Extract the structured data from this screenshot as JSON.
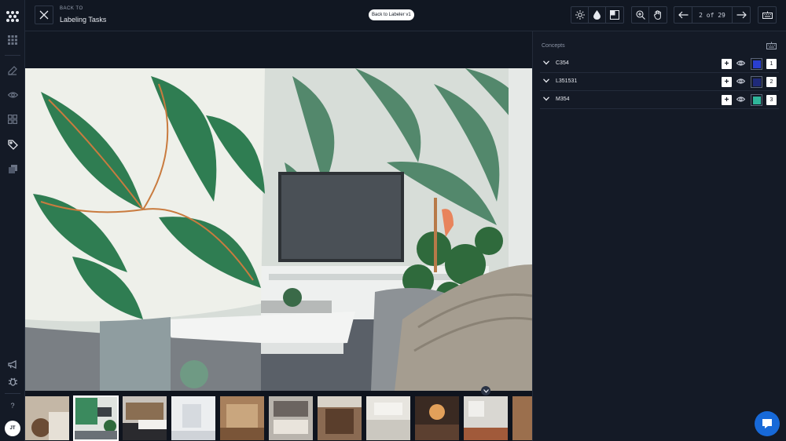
{
  "header": {
    "back_label": "BACK TO",
    "back_title": "Labeling Tasks",
    "back_to_labeler": "Back to Labeler v1",
    "pager": "2 of 29"
  },
  "user": {
    "initials": "JT"
  },
  "help_label": "?",
  "concepts": {
    "title": "Concepts",
    "items": [
      {
        "name": "C354",
        "color": "#2a3fd1",
        "shortcut": "1"
      },
      {
        "name": "L351531",
        "color": "#1f2a7a",
        "shortcut": "2"
      },
      {
        "name": "M354",
        "color": "#2fb59a",
        "shortcut": "3"
      }
    ]
  },
  "icons": {
    "rail": [
      "logo-icon",
      "apps-grid-icon",
      "edit-icon",
      "eye-icon",
      "grid-icon",
      "tag-icon",
      "copy-icon",
      "megaphone-icon",
      "bug-icon"
    ],
    "toolbar": [
      "brightness-icon",
      "saturation-icon",
      "contrast-icon",
      "zoom-in-icon",
      "hand-pan-icon",
      "arrow-left-icon",
      "arrow-right-icon",
      "keyboard-icon"
    ]
  },
  "colors": {
    "accent": "#1769d8",
    "background": "#111722",
    "panel": "#141a26"
  }
}
